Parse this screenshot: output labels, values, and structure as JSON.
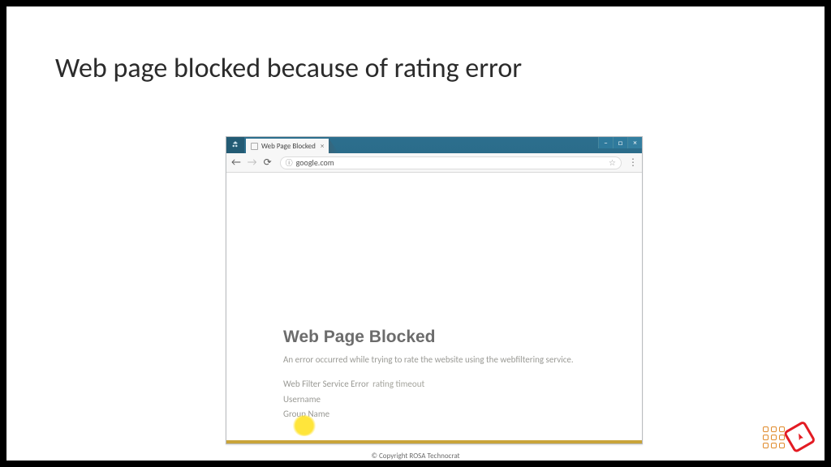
{
  "slide": {
    "title": "Web page blocked because of rating error"
  },
  "browser": {
    "tab_title": "Web Page Blocked",
    "url": "google.com",
    "win": {
      "min": "–",
      "max": "□",
      "close": "×"
    }
  },
  "blocked": {
    "heading": "Web Page Blocked",
    "message": "An error occurred while trying to rate the website using the webfiltering service.",
    "rows": {
      "service_error_label": "Web Filter Service Error",
      "service_error_value": "rating timeout",
      "username_label": "Username",
      "group_label": "Group Name"
    }
  },
  "footer": {
    "copyright": "© Copyright ROSA Technocrat"
  }
}
